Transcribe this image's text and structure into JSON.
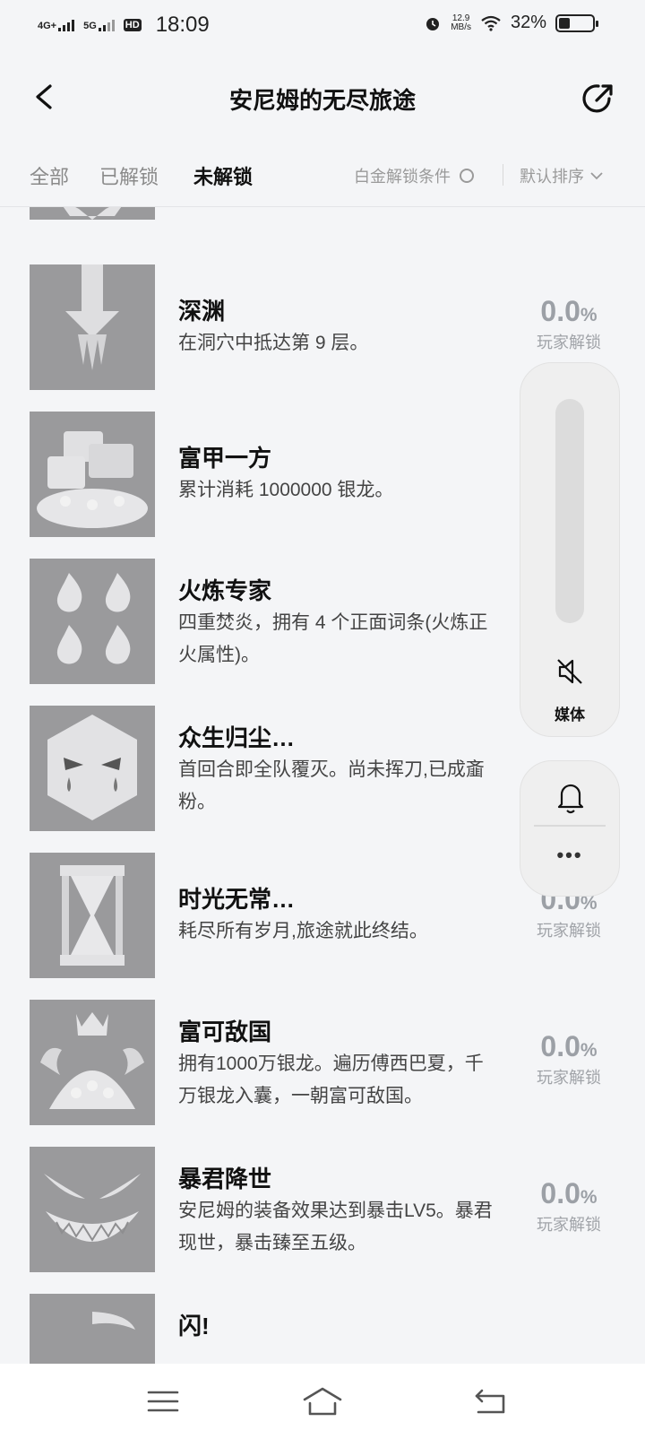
{
  "status_bar": {
    "signal1": "4G+",
    "signal2": "5G",
    "hd": "HD",
    "time": "18:09",
    "speed_value": "12.9",
    "speed_unit": "MB/s",
    "battery_percent": "32%",
    "battery_level": 0.32
  },
  "header": {
    "title": "安尼姆的无尽旅途",
    "back_icon": "chevron-left-icon",
    "share_icon": "share-icon"
  },
  "tabs": {
    "items": [
      "全部",
      "已解锁",
      "未解锁"
    ],
    "active": 2,
    "platinum_label": "白金解锁条件",
    "sort_label": "默认排序"
  },
  "achievements": [
    {
      "name": "",
      "desc": "",
      "pct": "",
      "unit": "",
      "pct_label": "",
      "icon": "crest-icon"
    },
    {
      "name": "深渊",
      "desc": "在洞穴中抵达第 9 层。",
      "pct": "0.0",
      "unit": "%",
      "pct_label": "玩家解锁",
      "icon": "downward-arrow-icon"
    },
    {
      "name": "富甲一方",
      "desc": "累计消耗 1000000 银龙。",
      "pct": "",
      "unit": "",
      "pct_label": "",
      "icon": "treasure-chest-icon"
    },
    {
      "name": "火炼专家",
      "desc": "四重焚炎，拥有 4 个正面词条(火炼正火属性)。",
      "pct": "",
      "unit": "",
      "pct_label": "",
      "icon": "four-flames-icon"
    },
    {
      "name": "众生归尘…",
      "desc": "首回合即全队覆灭。尚未挥刀,已成齑粉。",
      "pct": "",
      "unit": "",
      "pct_label": "",
      "icon": "crying-mask-icon"
    },
    {
      "name": "时光无常…",
      "desc": "耗尽所有岁月,旅途就此终结。",
      "pct": "0.0",
      "unit": "%",
      "pct_label": "玩家解锁",
      "icon": "hourglass-icon"
    },
    {
      "name": "富可敌国",
      "desc": "拥有1000万银龙。遍历傅西巴夏，千万银龙入囊，一朝富可敌国。",
      "pct": "0.0",
      "unit": "%",
      "pct_label": "玩家解锁",
      "icon": "dragon-crown-icon"
    },
    {
      "name": "暴君降世",
      "desc": "安尼姆的装备效果达到暴击LV5。暴君现世，暴击臻至五级。",
      "pct": "0.0",
      "unit": "%",
      "pct_label": "玩家解锁",
      "icon": "grin-face-icon"
    },
    {
      "name": "闪!",
      "desc": "",
      "pct": "",
      "unit": "",
      "pct_label": "",
      "icon": "feather-icon"
    }
  ],
  "volume_panel": {
    "media_label": "媒体",
    "mute_icon": "speaker-muted-icon",
    "bell_icon": "bell-icon",
    "more": "•••"
  },
  "navbar": {
    "menu_icon": "menu-icon",
    "home_icon": "home-icon",
    "back_icon": "back-icon"
  }
}
